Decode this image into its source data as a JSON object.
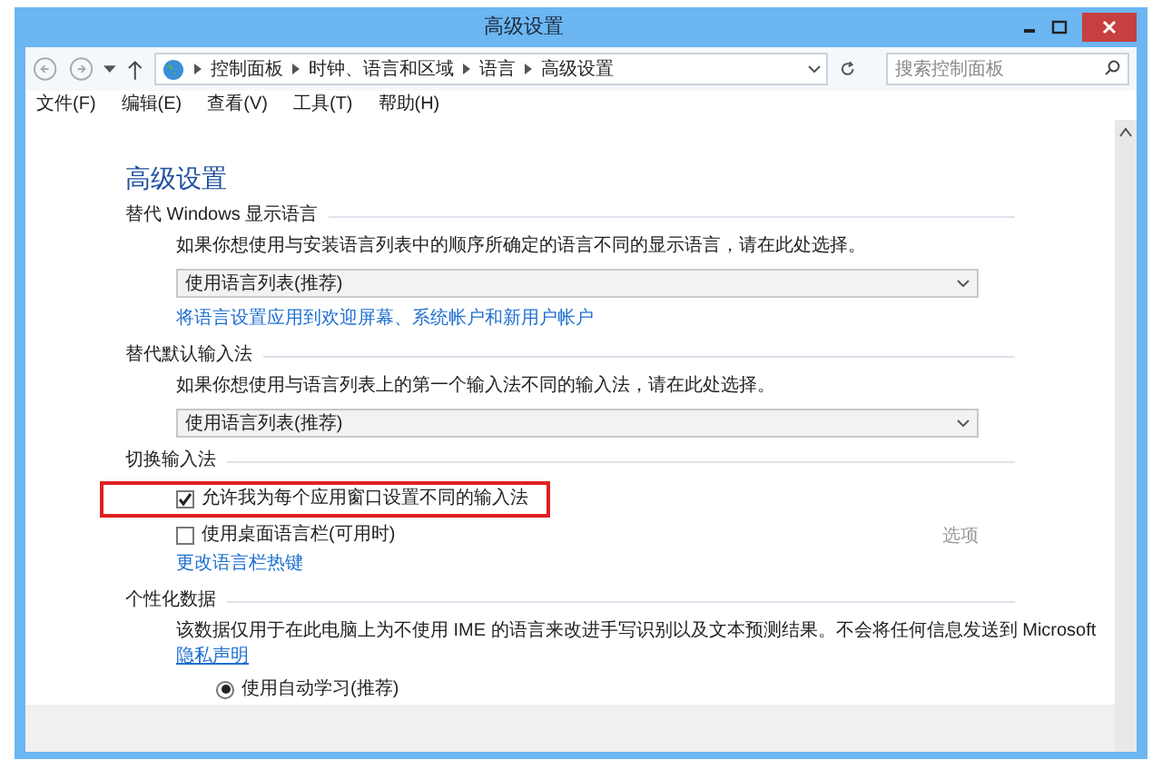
{
  "window": {
    "title": "高级设置"
  },
  "address_bar": {
    "path": [
      "控制面板",
      "时钟、语言和区域",
      "语言",
      "高级设置"
    ]
  },
  "search": {
    "placeholder": "搜索控制面板"
  },
  "menu": [
    "文件(F)",
    "编辑(E)",
    "查看(V)",
    "工具(T)",
    "帮助(H)"
  ],
  "heading": "高级设置",
  "sections": [
    {
      "title": "替代 Windows 显示语言",
      "items": [
        {
          "kind": "text",
          "text": "如果你想使用与安装语言列表中的顺序所确定的语言不同的显示语言，请在此处选择。"
        },
        {
          "kind": "dropdown",
          "value": "使用语言列表(推荐)"
        },
        {
          "kind": "link",
          "text": "将语言设置应用到欢迎屏幕、系统帐户和新用户帐户"
        }
      ]
    },
    {
      "title": "替代默认输入法",
      "items": [
        {
          "kind": "text",
          "text": "如果你想使用与语言列表上的第一个输入法不同的输入法，请在此处选择。"
        },
        {
          "kind": "dropdown",
          "value": "使用语言列表(推荐)"
        }
      ]
    },
    {
      "title": "切换输入法",
      "items": [
        {
          "kind": "checkbox",
          "label": "允许我为每个应用窗口设置不同的输入法",
          "checked": true,
          "highlighted": true
        },
        {
          "kind": "checkbox",
          "label": "使用桌面语言栏(可用时)",
          "checked": false,
          "highlighted": false,
          "option": "选项"
        },
        {
          "kind": "link",
          "text": "更改语言栏热键"
        }
      ]
    },
    {
      "title": "个性化数据",
      "items": [
        {
          "kind": "text",
          "text": "该数据仅用于在此电脑上为不使用 IME 的语言来改进手写识别以及文本预测结果。不会将任何信息发送到 Microsoft"
        },
        {
          "kind": "link",
          "text": "隐私声明",
          "underline": true
        },
        {
          "kind": "radio",
          "label": "使用自动学习(推荐)",
          "selected": true
        }
      ]
    }
  ]
}
